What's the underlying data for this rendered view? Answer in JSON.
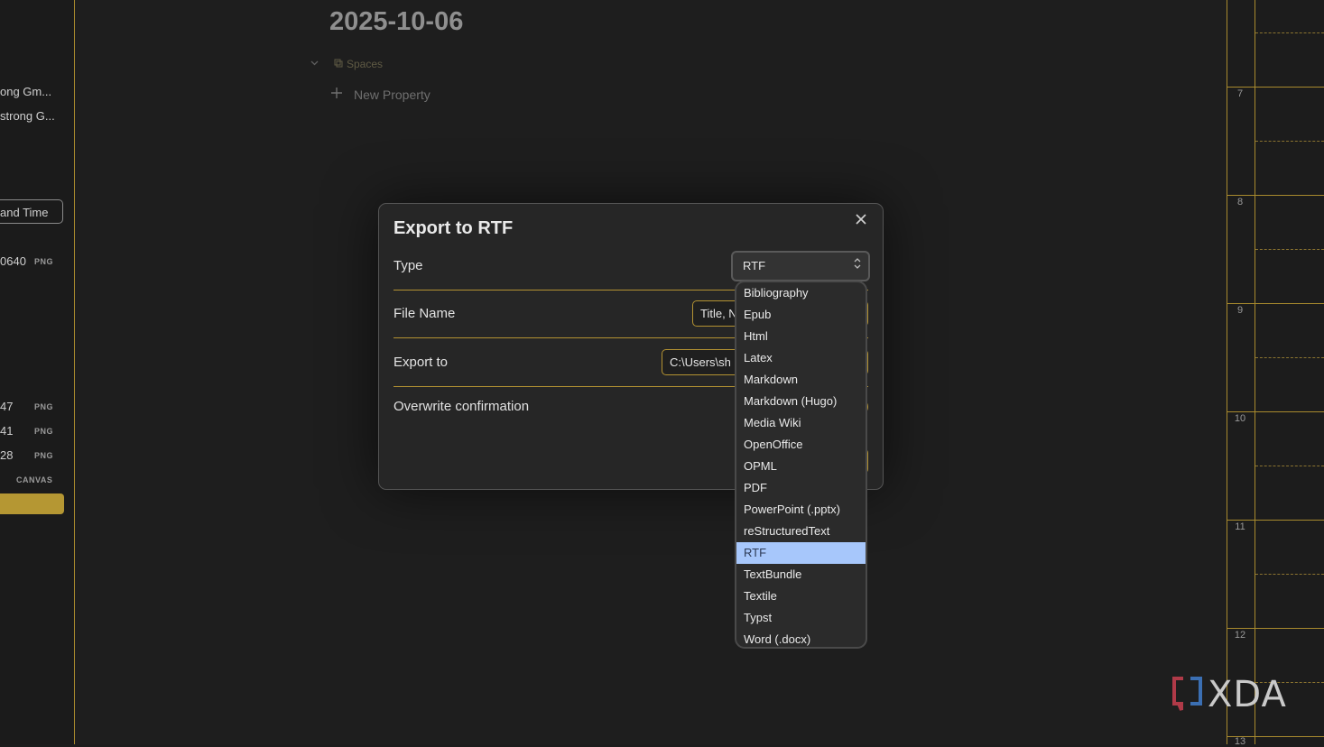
{
  "left_panel": {
    "item1": "ong Gm...",
    "item2": "strong G...",
    "date_time_button": "and Time",
    "file1": "0640",
    "file1_badge": "PNG",
    "file2": "47",
    "file2_badge": "PNG",
    "file3": "41",
    "file3_badge": "PNG",
    "file4": "28",
    "file4_badge": "PNG",
    "file5_badge": "CANVAS"
  },
  "note": {
    "title": "2025-10-06",
    "property_label": "Spaces",
    "new_property": "New Property"
  },
  "calendar": {
    "hours": [
      "7",
      "8",
      "9",
      "10",
      "11",
      "12",
      "13"
    ]
  },
  "watermark": {
    "text": "XDA"
  },
  "dialog": {
    "title": "Export to RTF",
    "type_label": "Type",
    "type_value": "RTF",
    "file_name_label": "File Name",
    "file_name_value": "Title, N",
    "export_to_label": "Export to",
    "export_to_value": "C:\\Users\\sh",
    "overwrite_label": "Overwrite confirmation"
  },
  "dropdown": {
    "options": [
      "Bibliography",
      "Epub",
      "Html",
      "Latex",
      "Markdown",
      "Markdown (Hugo)",
      "Media Wiki",
      "OpenOffice",
      "OPML",
      "PDF",
      "PowerPoint (.pptx)",
      "reStructuredText",
      "RTF",
      "TextBundle",
      "Textile",
      "Typst",
      "Word (.docx)"
    ],
    "selected": "RTF"
  },
  "colors": {
    "accent": "#b39232",
    "selection": "#a7c7fb",
    "background": "#1e1e1e"
  }
}
